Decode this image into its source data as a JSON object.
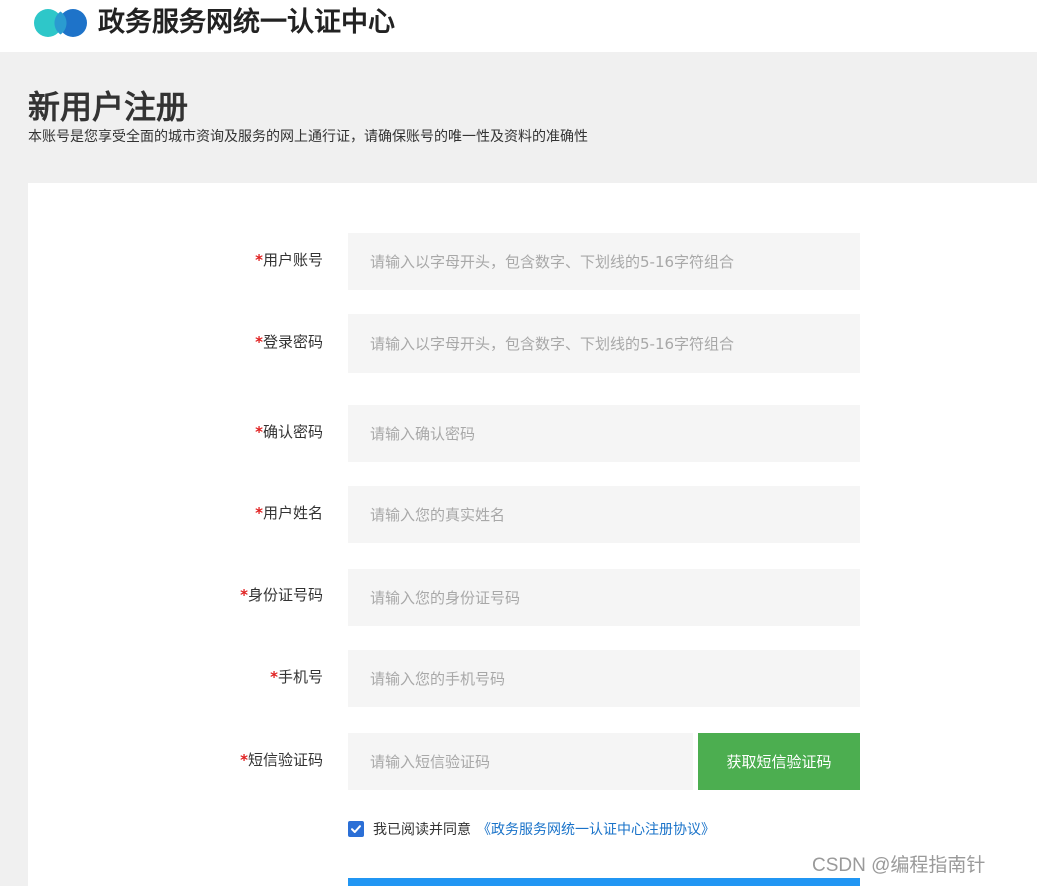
{
  "header": {
    "title": "政务服务网统一认证中心",
    "logo_colors": [
      "#2ec7c9",
      "#1e73c9"
    ]
  },
  "page": {
    "title": "新用户注册",
    "subtitle": "本账号是您享受全面的城市资询及服务的网上通行证，请确保账号的唯一性及资料的准确性"
  },
  "form": {
    "required_mark": "*",
    "fields": [
      {
        "label": "用户账号",
        "placeholder": "请输入以字母开头，包含数字、下划线的5-16字符组合"
      },
      {
        "label": "登录密码",
        "placeholder": "请输入以字母开头，包含数字、下划线的5-16字符组合"
      },
      {
        "label": "确认密码",
        "placeholder": "请输入确认密码"
      },
      {
        "label": "用户姓名",
        "placeholder": "请输入您的真实姓名"
      },
      {
        "label": "身份证号码",
        "placeholder": "请输入您的身份证号码"
      },
      {
        "label": "手机号",
        "placeholder": "请输入您的手机号码"
      },
      {
        "label": "短信验证码",
        "placeholder": "请输入短信验证码"
      }
    ],
    "sms_button_label": "获取短信验证码",
    "agree_checked": true,
    "agree_text": "我已阅读并同意",
    "agree_link": "《政务服务网统一认证中心注册协议》"
  },
  "watermark": "CSDN @编程指南针",
  "colors": {
    "accent_green": "#4cae50",
    "link_blue": "#1a73c9",
    "submit_blue": "#2196f3",
    "required_red": "#e02020"
  }
}
